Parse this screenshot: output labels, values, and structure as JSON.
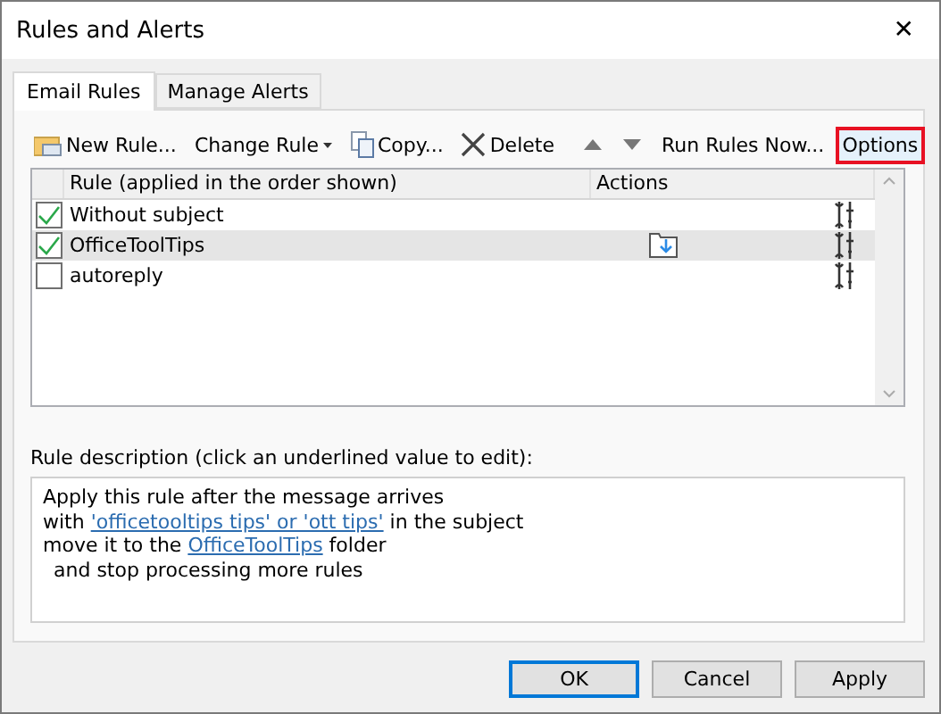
{
  "window": {
    "title": "Rules and Alerts",
    "close": "✕"
  },
  "tabs": [
    {
      "label": "Email Rules",
      "selected": true
    },
    {
      "label": "Manage Alerts",
      "selected": false
    }
  ],
  "toolbar": [
    {
      "kind": "new",
      "label": "New Rule...",
      "highlighted": false
    },
    {
      "kind": "change",
      "label": "Change Rule",
      "highlighted": false
    },
    {
      "kind": "copy",
      "label": "Copy...",
      "highlighted": false
    },
    {
      "kind": "delete",
      "label": "Delete",
      "highlighted": false
    },
    {
      "kind": "up",
      "highlighted": false
    },
    {
      "kind": "down",
      "highlighted": false
    },
    {
      "kind": "run",
      "label": "Run Rules Now...",
      "highlighted": false
    },
    {
      "kind": "options",
      "label": "Options",
      "highlighted": true
    }
  ],
  "table": {
    "columns": [
      "Rule (applied in the order shown)",
      "Actions"
    ],
    "rows": [
      {
        "name": "Without subject",
        "checked": true,
        "selected": false,
        "move_to_folder": false
      },
      {
        "name": "OfficeToolTips",
        "checked": true,
        "selected": true,
        "move_to_folder": true
      },
      {
        "name": "autoreply",
        "checked": false,
        "selected": false,
        "move_to_folder": false
      }
    ]
  },
  "description": {
    "label": "Rule description (click an underlined value to edit):",
    "lines": [
      {
        "indented": false,
        "parts": [
          {
            "text": "Apply this rule after the message arrives",
            "link": false
          }
        ]
      },
      {
        "indented": false,
        "parts": [
          {
            "text": "with ",
            "link": false
          },
          {
            "text": "'officetooltips tips' or 'ott tips'",
            "link": true
          },
          {
            "text": " in the subject",
            "link": false
          }
        ]
      },
      {
        "indented": false,
        "parts": [
          {
            "text": "move it to the ",
            "link": false
          },
          {
            "text": "OfficeToolTips",
            "link": true
          },
          {
            "text": " folder",
            "link": false
          }
        ]
      },
      {
        "indented": true,
        "parts": [
          {
            "text": "and stop processing more rules",
            "link": false
          }
        ]
      }
    ]
  },
  "buttons": [
    {
      "label": "OK",
      "default": true
    },
    {
      "label": "Cancel",
      "default": false
    },
    {
      "label": "Apply",
      "default": false
    }
  ]
}
